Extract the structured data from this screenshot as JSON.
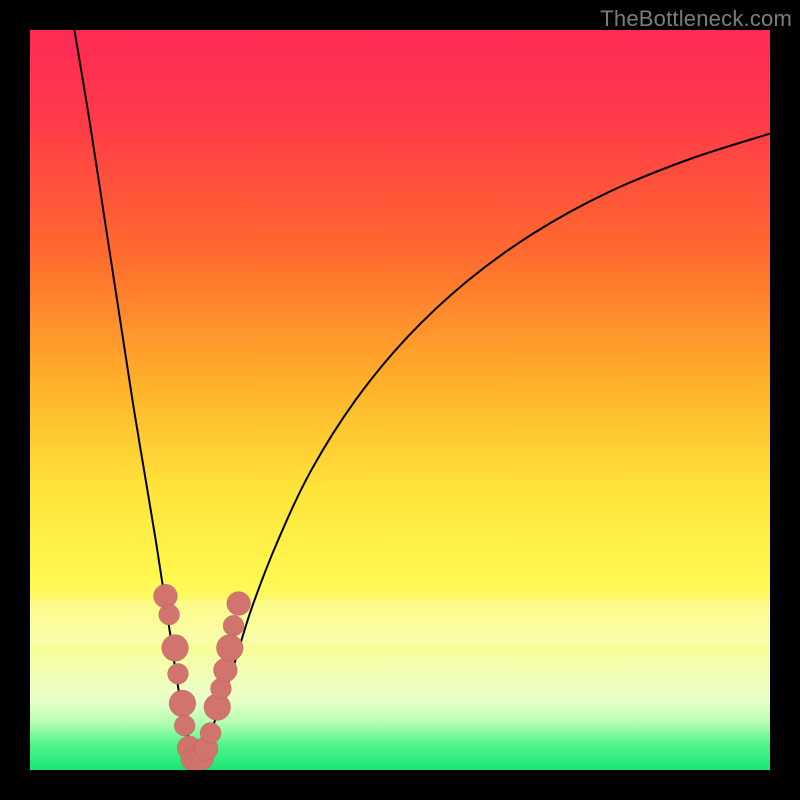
{
  "watermark": "TheBottleneck.com",
  "colors": {
    "frame": "#000000",
    "curve": "#000000",
    "dot_fill": "#d1746d",
    "dot_stroke": "#b35c56",
    "gradient_stops": [
      {
        "offset": 0.0,
        "color": "#ff2a55"
      },
      {
        "offset": 0.12,
        "color": "#ff3a49"
      },
      {
        "offset": 0.3,
        "color": "#ff6a2e"
      },
      {
        "offset": 0.48,
        "color": "#ffb22a"
      },
      {
        "offset": 0.62,
        "color": "#ffe33a"
      },
      {
        "offset": 0.74,
        "color": "#fff84f"
      },
      {
        "offset": 0.8,
        "color": "#fafc7c"
      },
      {
        "offset": 0.86,
        "color": "#f4ffaf"
      },
      {
        "offset": 0.905,
        "color": "#e9ffc9"
      },
      {
        "offset": 0.935,
        "color": "#b7ffb2"
      },
      {
        "offset": 0.965,
        "color": "#55f58a"
      },
      {
        "offset": 1.0,
        "color": "#19e676"
      }
    ]
  },
  "chart_data": {
    "type": "line",
    "title": "",
    "xlabel": "",
    "ylabel": "",
    "xlim": [
      0,
      100
    ],
    "ylim": [
      0,
      100
    ],
    "grid": false,
    "series": [
      {
        "name": "left-branch",
        "x": [
          6.0,
          8.0,
          10.0,
          12.0,
          14.0,
          15.5,
          17.0,
          18.0,
          19.0,
          19.8,
          20.5,
          21.2,
          21.8,
          22.3
        ],
        "values": [
          100,
          88,
          75,
          62,
          49,
          40,
          31,
          24.5,
          18,
          12.5,
          8.5,
          5.2,
          2.8,
          1.2
        ]
      },
      {
        "name": "right-branch",
        "x": [
          22.3,
          23.0,
          24.0,
          25.5,
          27.5,
          30.0,
          33.5,
          38.0,
          44.0,
          51.0,
          59.0,
          68.0,
          78.0,
          89.0,
          100.0
        ],
        "values": [
          1.2,
          2.2,
          4.3,
          8.0,
          14.0,
          22.0,
          31.0,
          40.5,
          50.0,
          58.5,
          66.0,
          72.5,
          78.0,
          82.5,
          86.0
        ]
      }
    ],
    "annotations": {
      "dots": [
        {
          "x": 18.3,
          "y": 23.5,
          "r": 1.6
        },
        {
          "x": 18.8,
          "y": 21.0,
          "r": 1.4
        },
        {
          "x": 19.6,
          "y": 16.5,
          "r": 1.8
        },
        {
          "x": 20.0,
          "y": 13.0,
          "r": 1.4
        },
        {
          "x": 20.6,
          "y": 9.0,
          "r": 1.8
        },
        {
          "x": 20.9,
          "y": 6.0,
          "r": 1.4
        },
        {
          "x": 21.5,
          "y": 3.0,
          "r": 1.6
        },
        {
          "x": 22.0,
          "y": 1.5,
          "r": 1.6
        },
        {
          "x": 22.6,
          "y": 1.3,
          "r": 1.6
        },
        {
          "x": 23.2,
          "y": 1.6,
          "r": 1.6
        },
        {
          "x": 23.8,
          "y": 2.9,
          "r": 1.6
        },
        {
          "x": 24.4,
          "y": 5.0,
          "r": 1.4
        },
        {
          "x": 25.3,
          "y": 8.5,
          "r": 1.8
        },
        {
          "x": 25.8,
          "y": 11.0,
          "r": 1.4
        },
        {
          "x": 26.4,
          "y": 13.5,
          "r": 1.6
        },
        {
          "x": 27.0,
          "y": 16.5,
          "r": 1.8
        },
        {
          "x": 27.5,
          "y": 19.5,
          "r": 1.4
        },
        {
          "x": 28.2,
          "y": 22.5,
          "r": 1.6
        }
      ]
    }
  }
}
